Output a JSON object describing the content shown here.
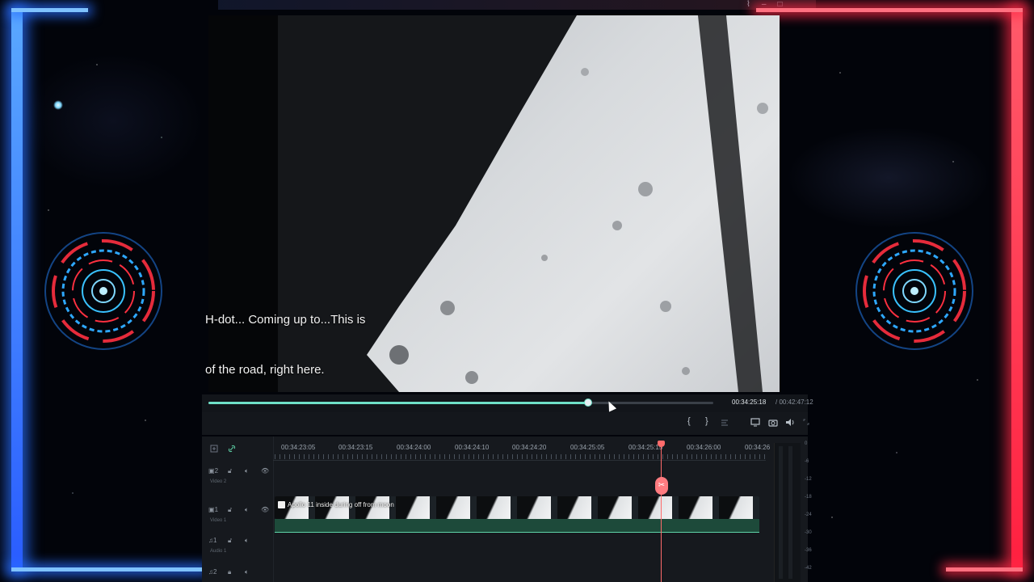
{
  "window": {
    "buttons": [
      "⌇",
      "–",
      "□"
    ]
  },
  "subtitles": {
    "line1": "H-dot... Coming up to...This is",
    "line2": "of the road, right here."
  },
  "player": {
    "current_time": "00:34:25:18",
    "total_time": "/ 00:42:47:12",
    "progress_fraction": 0.75,
    "controls": {
      "mark_in": "{",
      "mark_out": "}"
    }
  },
  "timeline": {
    "ruler": [
      "00:34:23:05",
      "00:34:23:15",
      "00:34:24:00",
      "00:34:24:10",
      "00:34:24:20",
      "00:34:25:05",
      "00:34:25:15",
      "00:34:26:00",
      "00:34:26"
    ],
    "tracks": [
      {
        "id": "video2",
        "number": "2",
        "name": "Video 2"
      },
      {
        "id": "video1",
        "number": "1",
        "name": "Video 1"
      },
      {
        "id": "audio1",
        "number": "1",
        "name": "Audio 1"
      },
      {
        "id": "audio2",
        "number": "2",
        "name": ""
      }
    ],
    "clip_title": "Apollo 11 inside during off from moon",
    "split_icon": "✂"
  },
  "meter": {
    "labels": [
      "0",
      "-6",
      "-12",
      "-18",
      "-24",
      "-30",
      "-36",
      "-42"
    ]
  },
  "colors": {
    "accent": "#6fe0c8",
    "playhead": "#ff6b6b",
    "frame_left": "#2a5cff",
    "frame_right": "#ff2040"
  }
}
